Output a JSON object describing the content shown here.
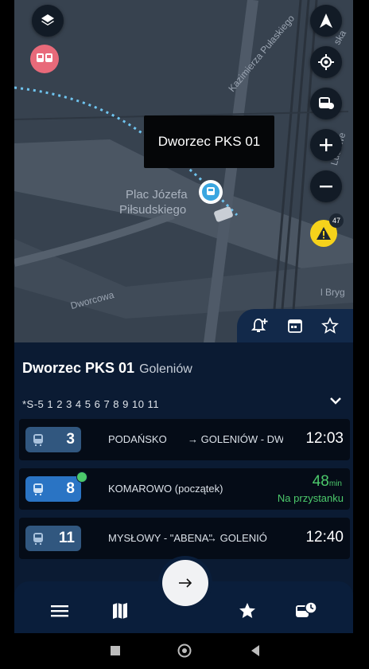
{
  "map": {
    "tooltip": "Dworzec PKS 01",
    "place_name_line1": "Plac Józefa",
    "place_name_line2": "Piłsudskiego",
    "streets": [
      "Kazimierza Pułaskiego",
      "Dworcowa",
      "l Bryg",
      "Ludowe",
      "ska"
    ],
    "alert_count": "47",
    "buttons": [
      "layers-icon",
      "north-arrow-icon",
      "locate-icon",
      "bus-filter-icon",
      "zoom-in-icon",
      "zoom-out-icon"
    ]
  },
  "stop": {
    "name": "Dworzec PKS 01",
    "city": "Goleniów",
    "lines": "*S-5 1 2 3 4 5 6 7 8 9 10 11"
  },
  "departures": [
    {
      "line": "3",
      "from": "PODAŃSKO",
      "to": "→ GOLENIÓW - DW",
      "time": "12:03",
      "realtime": false
    },
    {
      "line": "8",
      "from": "KOMAROWO (początek)",
      "to": "",
      "minutes": "48",
      "unit": "min",
      "status": "Na przystanku",
      "realtime": true
    },
    {
      "line": "11",
      "from": "MYSŁOWY - \"ABENA\"",
      "to": "→ GOLENIÓ",
      "time": "12:40",
      "realtime": false
    }
  ],
  "nav": [
    "menu-icon",
    "map-icon",
    "star-icon",
    "bus-schedule-icon"
  ],
  "colors": {
    "accent": "#2a74c4",
    "live": "#4cc96b",
    "panel": "#0b1b33",
    "alert": "#f6d21b"
  }
}
